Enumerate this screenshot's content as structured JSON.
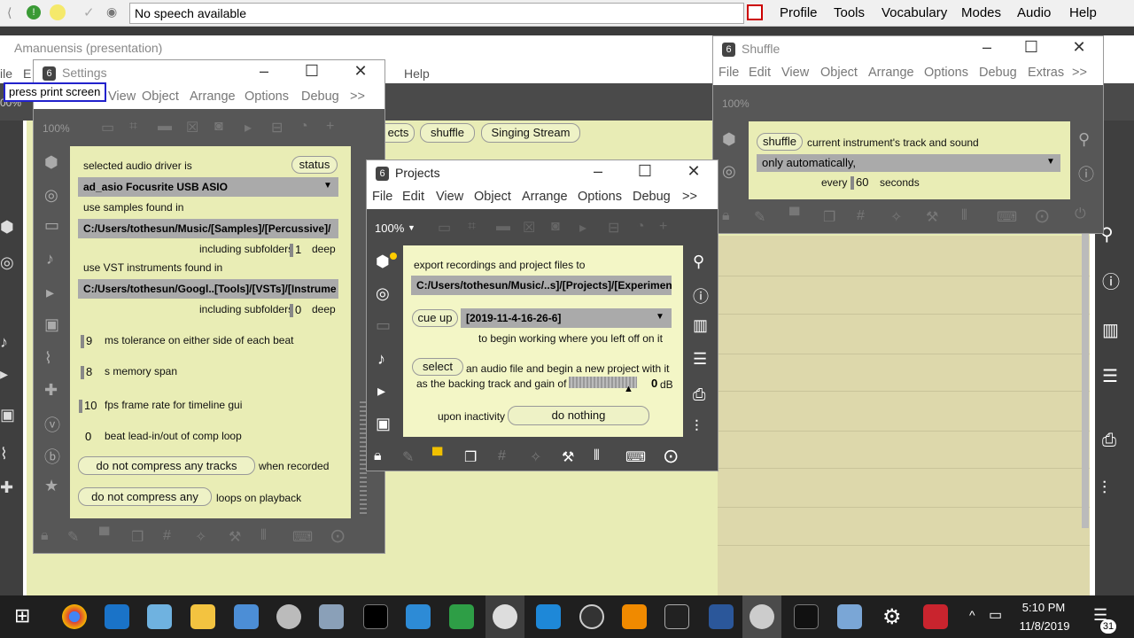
{
  "topbar": {
    "speech_status": "No speech available",
    "menu": [
      "Profile",
      "Tools",
      "Vocabulary",
      "Modes",
      "Audio",
      "Help"
    ]
  },
  "main_window": {
    "title": "Amanuensis (presentation)",
    "menu_partial": [
      "ile",
      "E",
      "Help"
    ],
    "zoom_partial": "00%",
    "buttons_partial": [
      "ects",
      "shuffle",
      "Singing Stream"
    ]
  },
  "settings": {
    "title": "Settings",
    "tooltip": "press print screen",
    "menu": [
      "View",
      "Object",
      "Arrange",
      "Options",
      "Debug",
      ">>"
    ],
    "zoom": "100%",
    "audio_driver_label": "selected audio driver is",
    "status_button": "status",
    "audio_driver_value": "ad_asio Focusrite USB ASIO",
    "samples_label": "use samples found in",
    "samples_path": "C:/Users/tothesun/Music/[Samples]/[Percussive]/",
    "samples_subfolders_label": "including subfolders",
    "samples_depth": "1",
    "samples_deep": "deep",
    "vst_label": "use VST instruments found in",
    "vst_path": "C:/Users/tothesun/Googl..[Tools]/[VSTs]/[Instrume",
    "vst_subfolders_label": "including subfolders",
    "vst_depth": "0",
    "vst_deep": "deep",
    "tolerance_value": "9",
    "tolerance_label": "ms tolerance on either side of each beat",
    "memory_value": "8",
    "memory_label": "s memory span",
    "fps_value": "10",
    "fps_label": "fps frame rate for timeline gui",
    "leadin_value": "0",
    "leadin_label": "beat lead-in/out of comp loop",
    "compress_tracks_button": "do not compress any tracks",
    "compress_tracks_suffix": "when recorded",
    "compress_loops_button": "do not compress any",
    "compress_loops_suffix": "loops on playback"
  },
  "shuffle": {
    "title": "Shuffle",
    "menu": [
      "File",
      "Edit",
      "View",
      "Object",
      "Arrange",
      "Options",
      "Debug",
      "Extras",
      ">>"
    ],
    "zoom": "100%",
    "shuffle_button": "shuffle",
    "description": "current instrument's track and sound",
    "mode_value": "only automatically,",
    "every_label": "every",
    "seconds_value": "60",
    "seconds_label": "seconds"
  },
  "projects": {
    "title": "Projects",
    "menu": [
      "File",
      "Edit",
      "View",
      "Object",
      "Arrange",
      "Options",
      "Debug",
      ">>"
    ],
    "zoom": "100%",
    "export_label": "export recordings and project files to",
    "export_path": "C:/Users/tothesun/Music/..s]/[Projects]/[Experimen",
    "cue_button": "cue up",
    "cue_value": "[2019-11-4-16-26-6]",
    "cue_hint": "to begin working where you left off on it",
    "select_button": "select",
    "select_label": "an audio file and begin a new project with it",
    "backing_label": "as the backing track and gain of",
    "gain_value": "0",
    "gain_unit": "dB",
    "inactivity_label": "upon inactivity",
    "inactivity_button": "do nothing"
  },
  "taskbar": {
    "time": "5:10 PM",
    "date": "11/8/2019",
    "notifications": "31"
  }
}
